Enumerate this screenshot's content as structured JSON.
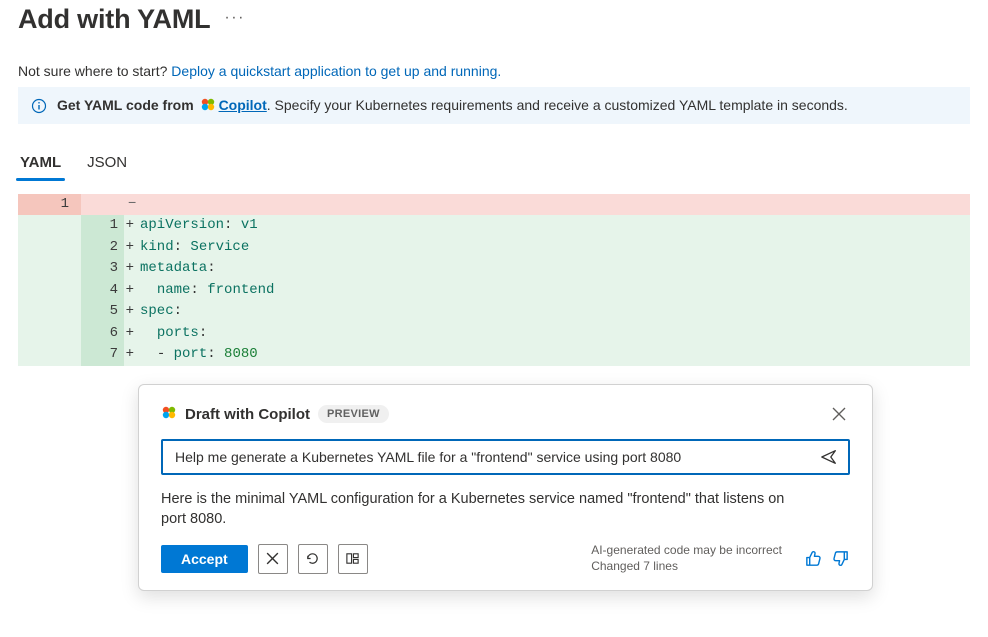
{
  "header": {
    "title": "Add with YAML"
  },
  "helper": {
    "prefix": "Not sure where to start? ",
    "link_text": "Deploy a quickstart application to get up and running."
  },
  "banner": {
    "bold_prefix": "Get YAML code from ",
    "link_text": "Copilot",
    "suffix": ". Specify your Kubernetes requirements and receive a customized YAML template in seconds."
  },
  "tabs": {
    "yaml": "YAML",
    "json": "JSON"
  },
  "diff": {
    "removed_line_no": "1",
    "removed_marker": "−",
    "lines": [
      {
        "n": "1",
        "html": "<span class='tok-key'>apiVersion</span><span class='tok-punc'>:</span> <span class='tok-val'>v1</span>"
      },
      {
        "n": "2",
        "html": "<span class='tok-key'>kind</span><span class='tok-punc'>:</span> <span class='tok-val'>Service</span>"
      },
      {
        "n": "3",
        "html": "<span class='tok-key'>metadata</span><span class='tok-punc'>:</span>"
      },
      {
        "n": "4",
        "html": "  <span class='tok-key'>name</span><span class='tok-punc'>:</span> <span class='tok-val'>frontend</span>"
      },
      {
        "n": "5",
        "html": "<span class='tok-key'>spec</span><span class='tok-punc'>:</span>"
      },
      {
        "n": "6",
        "html": "  <span class='tok-key'>ports</span><span class='tok-punc'>:</span>"
      },
      {
        "n": "7",
        "html": "  <span class='tok-punc'>-</span> <span class='tok-key'>port</span><span class='tok-punc'>:</span> <span class='tok-num'>8080</span>"
      }
    ]
  },
  "copilot": {
    "title": "Draft with Copilot",
    "badge": "PREVIEW",
    "prompt_value": "Help me generate a Kubernetes YAML file for a \"frontend\" service using port 8080",
    "response": "Here is the minimal YAML configuration for a Kubernetes service named \"frontend\" that listens on port 8080.",
    "accept_label": "Accept",
    "ai_note_line1": "AI-generated code may be incorrect",
    "ai_note_line2": "Changed 7 lines"
  }
}
